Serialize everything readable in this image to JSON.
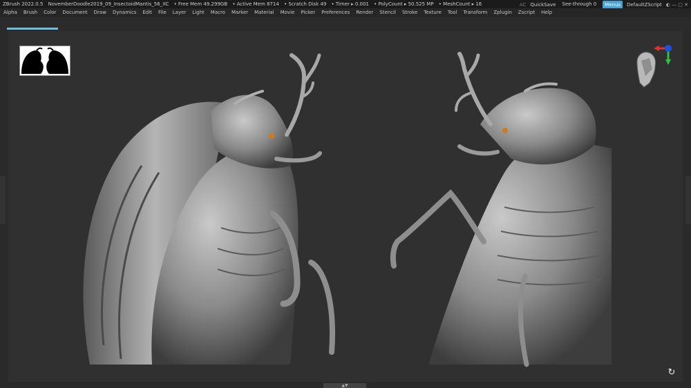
{
  "titlebar": {
    "app": "ZBrush 2022.0.5",
    "document": "NovemberDoodle2019_09_InsectoidMantis_56_XC",
    "free_mem": "• Free Mem 49.299GB",
    "active_mem": "• Active Mem 8714",
    "scratch_disk": "• Scratch Disk 49",
    "timer": "• Timer ▸ 0.001",
    "polycount": "• PolyCount ▸ 50.525 MP",
    "meshcount": "• MeshCount ▸ 16",
    "ac": "AC",
    "quicksave": "QuickSave",
    "see_through": "See-through  0",
    "menus": "Menus",
    "default_zscript": "DefaultZScript",
    "win_controls": "◐ — ▢ ✕"
  },
  "menubar": [
    "Alpha",
    "Brush",
    "Color",
    "Document",
    "Draw",
    "Dynamics",
    "Edit",
    "File",
    "Layer",
    "Light",
    "Macro",
    "Marker",
    "Material",
    "Movie",
    "Picker",
    "Preferences",
    "Render",
    "Stencil",
    "Stroke",
    "Texture",
    "Tool",
    "Transform",
    "Zplugin",
    "Zscript",
    "Help"
  ],
  "canvas": {
    "bottom_handle": "▲▼",
    "refresh_icon": "↻"
  },
  "colors": {
    "accent": "#4aa3d6",
    "doc_tab": "#6fbde0",
    "eye": "#d07a1a"
  }
}
